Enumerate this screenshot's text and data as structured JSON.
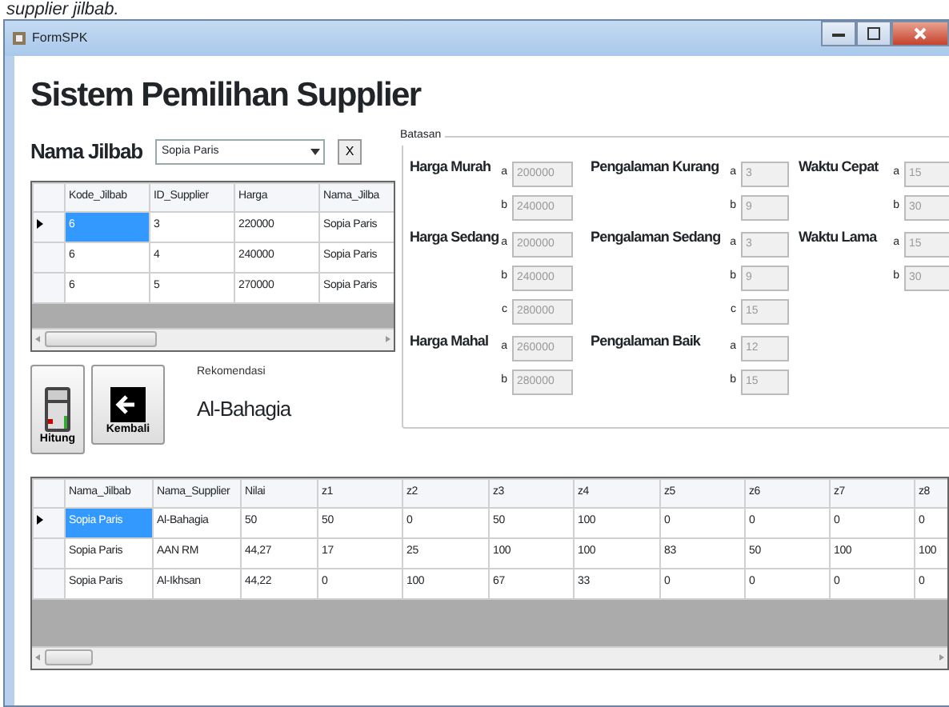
{
  "doc_caption": "supplier jilbab.",
  "window": {
    "title": "FormSPK"
  },
  "heading": "Sistem Pemilihan Supplier",
  "jilbab": {
    "label": "Nama Jilbab",
    "value": "Sopia Paris",
    "clear_button": "X"
  },
  "top_grid": {
    "columns": [
      "Kode_Jilbab",
      "ID_Supplier",
      "Harga",
      "Nama_Jilba"
    ],
    "rows": [
      {
        "selected": true,
        "cells": [
          "6",
          "3",
          "220000",
          "Sopia Paris"
        ]
      },
      {
        "selected": false,
        "cells": [
          "6",
          "4",
          "240000",
          "Sopia Paris"
        ]
      },
      {
        "selected": false,
        "cells": [
          "6",
          "5",
          "270000",
          "Sopia Paris"
        ]
      }
    ]
  },
  "buttons": [
    {
      "kind": "calculator",
      "label": "Hitung"
    },
    {
      "kind": "back",
      "label": "Kembali"
    }
  ],
  "recommendation": {
    "label": "Rekomendasi",
    "value": "Al-Bahagia"
  },
  "batasan": {
    "title": "Batasan",
    "rows": [
      [
        {
          "label": "Harga Murah",
          "fields": [
            {
              "letter": "a",
              "value": "200000",
              "disabled": true
            },
            {
              "letter": "b",
              "value": "240000",
              "disabled": true
            }
          ]
        },
        {
          "label": "Pengalaman Kurang",
          "fields": [
            {
              "letter": "a",
              "value": "3",
              "disabled": true
            },
            {
              "letter": "b",
              "value": "9",
              "disabled": true
            }
          ]
        },
        {
          "label": "Waktu Cepat",
          "fields": [
            {
              "letter": "a",
              "value": "15",
              "disabled": true
            },
            {
              "letter": "b",
              "value": "30",
              "disabled": true
            }
          ]
        }
      ],
      [
        {
          "label": "Harga Sedang",
          "fields": [
            {
              "letter": "a",
              "value": "200000",
              "disabled": true
            },
            {
              "letter": "b",
              "value": "240000",
              "disabled": true
            },
            {
              "letter": "c",
              "value": "280000",
              "disabled": true
            }
          ]
        },
        {
          "label": "Pengalaman Sedang",
          "fields": [
            {
              "letter": "a",
              "value": "3",
              "disabled": true
            },
            {
              "letter": "b",
              "value": "9",
              "disabled": true
            },
            {
              "letter": "c",
              "value": "15",
              "disabled": true
            }
          ]
        },
        {
          "label": "Waktu Lama",
          "fields": [
            {
              "letter": "a",
              "value": "15",
              "disabled": true
            },
            {
              "letter": "b",
              "value": "30",
              "disabled": true
            }
          ]
        }
      ],
      [
        {
          "label": "Harga Mahal",
          "fields": [
            {
              "letter": "a",
              "value": "260000",
              "disabled": true
            },
            {
              "letter": "b",
              "value": "280000",
              "disabled": true
            }
          ]
        },
        {
          "label": "Pengalaman Baik",
          "fields": [
            {
              "letter": "a",
              "value": "12",
              "disabled": true
            },
            {
              "letter": "b",
              "value": "15",
              "disabled": true
            }
          ]
        }
      ]
    ]
  },
  "result_grid": {
    "columns": [
      "Nama_Jilbab",
      "Nama_Supplier",
      "Nilai",
      "z1",
      "z2",
      "z3",
      "z4",
      "z5",
      "z6",
      "z7",
      "z8"
    ],
    "rows": [
      {
        "selected": true,
        "cells": [
          "Sopia Paris",
          "Al-Bahagia",
          "50",
          "50",
          "0",
          "50",
          "100",
          "0",
          "0",
          "0",
          "0"
        ]
      },
      {
        "selected": false,
        "cells": [
          "Sopia Paris",
          "AAN RM",
          "44,27",
          "17",
          "25",
          "100",
          "100",
          "83",
          "50",
          "100",
          "100"
        ]
      },
      {
        "selected": false,
        "cells": [
          "Sopia Paris",
          "Al-Ikhsan",
          "44,22",
          "0",
          "100",
          "67",
          "33",
          "0",
          "0",
          "0",
          "0"
        ]
      }
    ]
  }
}
